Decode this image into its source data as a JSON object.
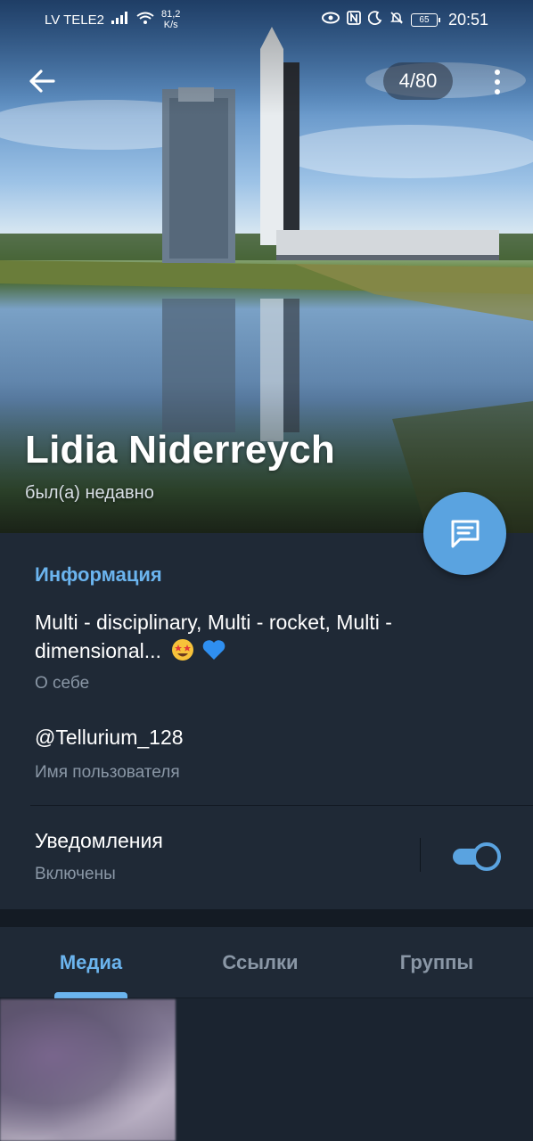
{
  "status_bar": {
    "carrier": "LV TELE2",
    "net_speed_value": "81,2",
    "net_speed_unit": "K/s",
    "battery": "65",
    "time": "20:51",
    "icons": [
      "signal-icon",
      "wifi-icon",
      "eye-icon",
      "nfc-icon",
      "moon-icon",
      "bell-off-icon",
      "battery-icon"
    ]
  },
  "header": {
    "photo_counter": "4/80",
    "name": "Lidia Niderreych",
    "last_seen": "был(а) недавно",
    "back_icon": "arrow-left-icon",
    "menu_icon": "more-vertical-icon",
    "fab_icon": "message-icon"
  },
  "info": {
    "heading": "Информация",
    "bio": "Multi - disciplinary, Multi - rocket, Multi - dimensional...",
    "bio_emojis": [
      "star-struck-emoji",
      "blue-heart-emoji"
    ],
    "bio_caption": "О себе",
    "username": "@Tellurium_128",
    "username_caption": "Имя пользователя",
    "notifications_title": "Уведомления",
    "notifications_state": "Включены",
    "notifications_enabled": true
  },
  "tabs": [
    {
      "label": "Медиа",
      "active": true
    },
    {
      "label": "Ссылки",
      "active": false
    },
    {
      "label": "Группы",
      "active": false
    }
  ],
  "colors": {
    "accent": "#5aa3e0",
    "accent_text": "#6bb4ee",
    "background": "#1f2936",
    "secondary_text": "#8a97a6"
  }
}
